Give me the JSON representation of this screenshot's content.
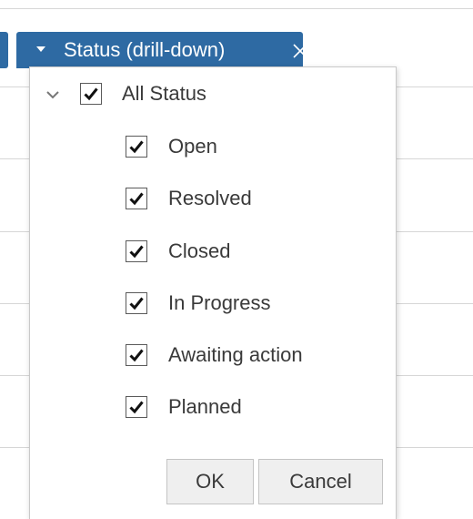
{
  "filter_chip": {
    "label": "Status (drill-down)",
    "background": "#2e6aa3"
  },
  "tree": {
    "root": {
      "label": "All Status",
      "checked": true,
      "expanded": true
    },
    "children": [
      {
        "label": "Open",
        "checked": true
      },
      {
        "label": "Resolved",
        "checked": true
      },
      {
        "label": "Closed",
        "checked": true
      },
      {
        "label": "In Progress",
        "checked": true
      },
      {
        "label": "Awaiting action",
        "checked": true
      },
      {
        "label": "Planned",
        "checked": true
      }
    ]
  },
  "buttons": {
    "ok_label": "OK",
    "cancel_label": "Cancel"
  },
  "icons": {
    "caret": "caret-down-icon",
    "close": "close-icon",
    "toggle": "chevron-down-icon",
    "check": "checkmark-icon"
  }
}
